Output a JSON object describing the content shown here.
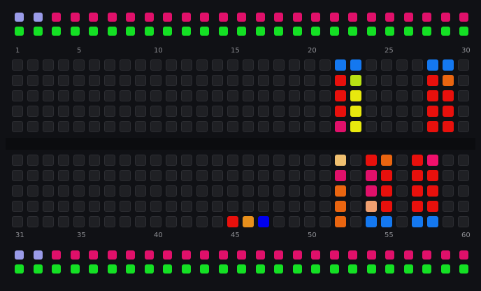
{
  "colors": {
    "empty": "#1f2024",
    "lavender": "#9a9be8",
    "magenta": "#e0106a",
    "green": "#14e024",
    "blue": "#1478f0",
    "red": "#e8100c",
    "yellow": "#e8e80e",
    "lime": "#b8e014",
    "orange": "#ea6510",
    "amber": "#e8901c",
    "peach": "#f0c070",
    "salmon": "#f0a070",
    "pure_blue": "#0000f0",
    "pink": "#f0106c"
  },
  "top_strip": {
    "row1": [
      "lavender",
      "lavender",
      "magenta",
      "magenta",
      "magenta",
      "magenta",
      "magenta",
      "magenta",
      "magenta",
      "magenta",
      "magenta",
      "magenta",
      "magenta",
      "magenta",
      "magenta",
      "magenta",
      "magenta",
      "magenta",
      "magenta",
      "magenta",
      "magenta",
      "magenta",
      "magenta",
      "magenta",
      "magenta"
    ],
    "row2": [
      "green",
      "green",
      "green",
      "green",
      "green",
      "green",
      "green",
      "green",
      "green",
      "green",
      "green",
      "green",
      "green",
      "green",
      "green",
      "green",
      "green",
      "green",
      "green",
      "green",
      "green",
      "green",
      "green",
      "green",
      "green"
    ]
  },
  "bottom_strip": {
    "row1": [
      "lavender",
      "lavender",
      "magenta",
      "magenta",
      "magenta",
      "magenta",
      "magenta",
      "magenta",
      "magenta",
      "magenta",
      "magenta",
      "magenta",
      "magenta",
      "magenta",
      "magenta",
      "magenta",
      "magenta",
      "magenta",
      "magenta",
      "magenta",
      "magenta",
      "magenta",
      "magenta",
      "magenta",
      "magenta"
    ],
    "row2": [
      "green",
      "green",
      "green",
      "green",
      "green",
      "green",
      "green",
      "green",
      "green",
      "green",
      "green",
      "green",
      "green",
      "green",
      "green",
      "green",
      "green",
      "green",
      "green",
      "green",
      "green",
      "green",
      "green",
      "green",
      "green"
    ]
  },
  "top_labels": [
    {
      "col": 1,
      "text": "1"
    },
    {
      "col": 5,
      "text": "5"
    },
    {
      "col": 10,
      "text": "10"
    },
    {
      "col": 15,
      "text": "15"
    },
    {
      "col": 20,
      "text": "20"
    },
    {
      "col": 25,
      "text": "25"
    },
    {
      "col": 30,
      "text": "30"
    }
  ],
  "bottom_labels": [
    {
      "col": 1,
      "text": "31"
    },
    {
      "col": 5,
      "text": "35"
    },
    {
      "col": 10,
      "text": "40"
    },
    {
      "col": 15,
      "text": "45"
    },
    {
      "col": 20,
      "text": "50"
    },
    {
      "col": 25,
      "text": "55"
    },
    {
      "col": 30,
      "text": "60"
    }
  ],
  "top_grid": [
    [
      null,
      null,
      null,
      null,
      null,
      null,
      null,
      null,
      null,
      null,
      null,
      null,
      null,
      null,
      null,
      null,
      null,
      null,
      null,
      null,
      null,
      "blue",
      "blue",
      null,
      null,
      null,
      null,
      "blue",
      "blue",
      null
    ],
    [
      null,
      null,
      null,
      null,
      null,
      null,
      null,
      null,
      null,
      null,
      null,
      null,
      null,
      null,
      null,
      null,
      null,
      null,
      null,
      null,
      null,
      "red",
      "lime",
      null,
      null,
      null,
      null,
      "red",
      "orange",
      null
    ],
    [
      null,
      null,
      null,
      null,
      null,
      null,
      null,
      null,
      null,
      null,
      null,
      null,
      null,
      null,
      null,
      null,
      null,
      null,
      null,
      null,
      null,
      "red",
      "yellow",
      null,
      null,
      null,
      null,
      "red",
      "red",
      null
    ],
    [
      null,
      null,
      null,
      null,
      null,
      null,
      null,
      null,
      null,
      null,
      null,
      null,
      null,
      null,
      null,
      null,
      null,
      null,
      null,
      null,
      null,
      "red",
      "yellow",
      null,
      null,
      null,
      null,
      "red",
      "red",
      null
    ],
    [
      null,
      null,
      null,
      null,
      null,
      null,
      null,
      null,
      null,
      null,
      null,
      null,
      null,
      null,
      null,
      null,
      null,
      null,
      null,
      null,
      null,
      "magenta",
      "yellow",
      null,
      null,
      null,
      null,
      "red",
      "red",
      null
    ]
  ],
  "bottom_grid": [
    [
      null,
      null,
      null,
      null,
      null,
      null,
      null,
      null,
      null,
      null,
      null,
      null,
      null,
      null,
      null,
      null,
      null,
      null,
      null,
      null,
      null,
      "peach",
      null,
      "red",
      "orange",
      null,
      "red",
      "pink",
      null,
      null
    ],
    [
      null,
      null,
      null,
      null,
      null,
      null,
      null,
      null,
      null,
      null,
      null,
      null,
      null,
      null,
      null,
      null,
      null,
      null,
      null,
      null,
      null,
      "magenta",
      null,
      "magenta",
      "red",
      null,
      "red",
      "red",
      null,
      null
    ],
    [
      null,
      null,
      null,
      null,
      null,
      null,
      null,
      null,
      null,
      null,
      null,
      null,
      null,
      null,
      null,
      null,
      null,
      null,
      null,
      null,
      null,
      "orange",
      null,
      "magenta",
      "red",
      null,
      "red",
      "red",
      null,
      null
    ],
    [
      null,
      null,
      null,
      null,
      null,
      null,
      null,
      null,
      null,
      null,
      null,
      null,
      null,
      null,
      null,
      null,
      null,
      null,
      null,
      null,
      null,
      "orange",
      null,
      "salmon",
      "red",
      null,
      "red",
      "red",
      null,
      null
    ],
    [
      null,
      null,
      null,
      null,
      null,
      null,
      null,
      null,
      null,
      null,
      null,
      null,
      null,
      null,
      "red",
      "amber",
      "pure_blue",
      null,
      null,
      null,
      null,
      "orange",
      null,
      "blue",
      "blue",
      null,
      "blue",
      "blue",
      null,
      null
    ]
  ]
}
